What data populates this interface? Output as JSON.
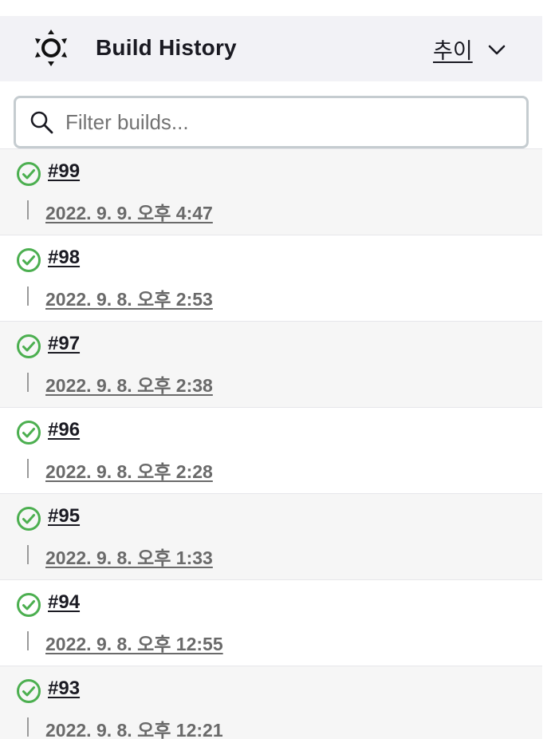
{
  "header": {
    "title": "Build History",
    "trend_label": "추이"
  },
  "search": {
    "placeholder": "Filter builds...",
    "value": ""
  },
  "colors": {
    "success": "#4caf50",
    "header_bg": "#f2f2f6",
    "row_shade": "#f6f6f6"
  },
  "builds": [
    {
      "number": "#99",
      "time": "2022. 9. 9. 오후 4:47",
      "status": "success-icon"
    },
    {
      "number": "#98",
      "time": "2022. 9. 8. 오후 2:53",
      "status": "success-icon"
    },
    {
      "number": "#97",
      "time": "2022. 9. 8. 오후 2:38",
      "status": "success-icon"
    },
    {
      "number": "#96",
      "time": "2022. 9. 8. 오후 2:28",
      "status": "success-icon"
    },
    {
      "number": "#95",
      "time": "2022. 9. 8. 오후 1:33",
      "status": "success-icon"
    },
    {
      "number": "#94",
      "time": "2022. 9. 8. 오후 12:55",
      "status": "success-icon"
    },
    {
      "number": "#93",
      "time": "2022. 9. 8. 오후 12:21",
      "status": "success-icon"
    }
  ]
}
